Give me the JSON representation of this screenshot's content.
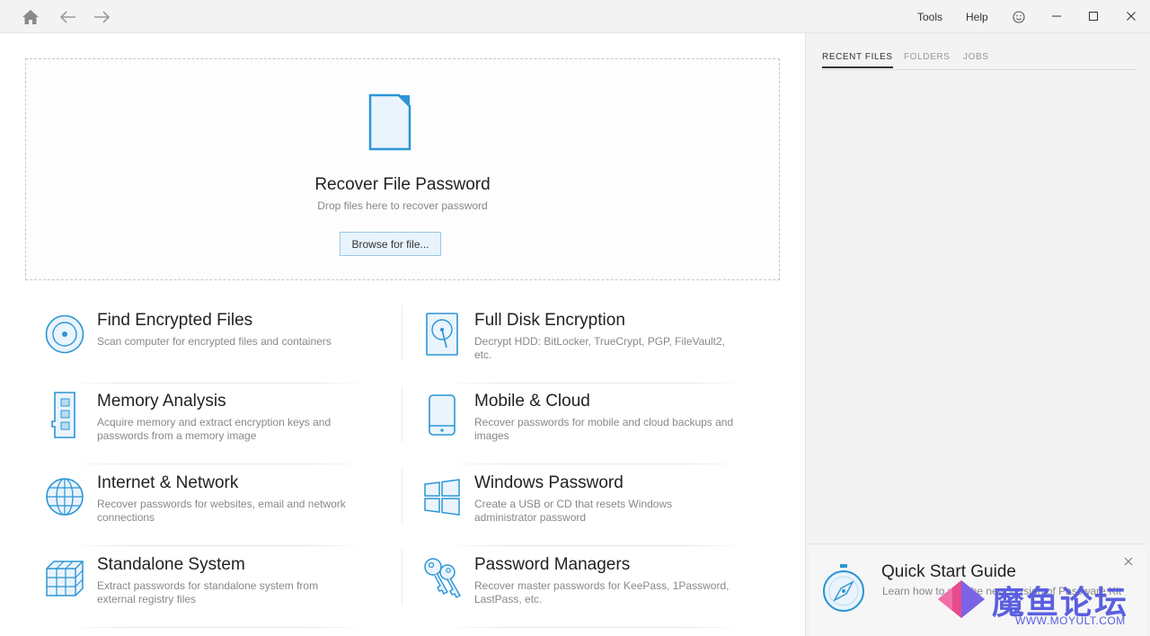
{
  "titlebar": {
    "menu_tools": "Tools",
    "menu_help": "Help"
  },
  "dropzone": {
    "title": "Recover File Password",
    "subtitle": "Drop files here to recover password",
    "browse_label": "Browse for file..."
  },
  "tiles": [
    {
      "icon": "scan-disc-icon",
      "title": "Find Encrypted Files",
      "desc": "Scan computer for encrypted files and containers"
    },
    {
      "icon": "hard-disk-icon",
      "title": "Full Disk Encryption",
      "desc": "Decrypt HDD: BitLocker, TrueCrypt, PGP, FileVault2, etc."
    },
    {
      "icon": "memory-chip-icon",
      "title": "Memory Analysis",
      "desc": "Acquire memory and extract encryption keys and passwords from a memory image"
    },
    {
      "icon": "mobile-phone-icon",
      "title": "Mobile & Cloud",
      "desc": "Recover passwords for mobile and cloud backups and images"
    },
    {
      "icon": "globe-icon",
      "title": "Internet & Network",
      "desc": "Recover passwords for websites, email and network connections"
    },
    {
      "icon": "windows-logo-icon",
      "title": "Windows Password",
      "desc": "Create a USB or CD that resets Windows administrator password"
    },
    {
      "icon": "cubes-icon",
      "title": "Standalone System",
      "desc": "Extract passwords for standalone system from external registry files"
    },
    {
      "icon": "keys-icon",
      "title": "Password Managers",
      "desc": "Recover master passwords for KeePass, 1Password, LastPass, etc."
    }
  ],
  "side": {
    "tabs": [
      {
        "label": "RECENT FILES",
        "active": true
      },
      {
        "label": "FOLDERS",
        "active": false
      },
      {
        "label": "JOBS",
        "active": false
      }
    ]
  },
  "quickstart": {
    "title": "Quick Start Guide",
    "desc": "Learn how to use the new version of Passware Kit"
  },
  "watermark": {
    "text": "魔鱼论坛",
    "url": "WWW.MOYULT.COM"
  },
  "colors": {
    "accent": "#2b95d6",
    "accent_light": "#e8f3fb"
  }
}
